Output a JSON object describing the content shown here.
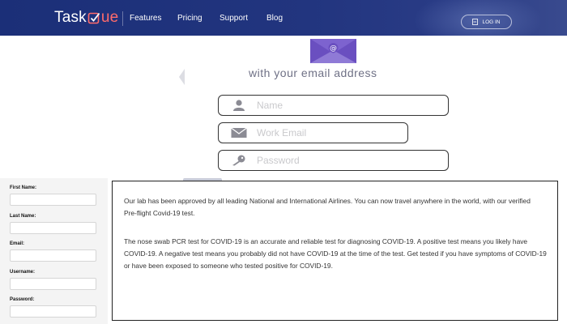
{
  "header": {
    "logo": {
      "part1": "Task",
      "part2": "ue"
    },
    "nav": [
      "Features",
      "Pricing",
      "Support",
      "Blog"
    ],
    "login_label": "LOG IN",
    "login_icon": "login-icon"
  },
  "signup": {
    "heading": "with your email address",
    "fields": [
      {
        "placeholder": "Name",
        "icon": "user-icon"
      },
      {
        "placeholder": "Work Email",
        "icon": "envelope-icon"
      },
      {
        "placeholder": "Password",
        "icon": "key-icon"
      }
    ]
  },
  "side_form": {
    "labels": [
      "First Name:",
      "Last Name:",
      "Email:",
      "Username:",
      "Password:"
    ]
  },
  "info": {
    "paragraph1": "Our lab has been approved by all leading National and International Airlines. You can now travel anywhere in the world, with our verified Pre-flight Covid-19 test.",
    "paragraph2": "The nose swab PCR test for COVID-19 is an accurate and reliable test for diagnosing COVID-19. A positive test means you likely have COVID-19. A negative test means you probably did not have COVID-19 at the time of the test. Get tested if you have symptoms of COVID-19 or have been exposed to someone who tested positive for COVID-19."
  },
  "colors": {
    "header_bg": "#1b2f78",
    "logo_accent": "#ff6b6b",
    "envelope": "#5a3fa8"
  }
}
